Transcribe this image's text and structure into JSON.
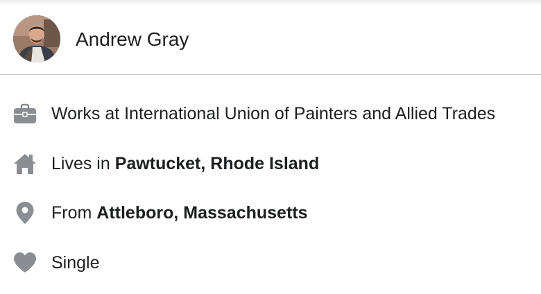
{
  "profile": {
    "name": "Andrew Gray"
  },
  "details": {
    "work": {
      "icon": "briefcase-icon",
      "prefix": "Works at International Union of Painters and Allied Trades"
    },
    "lives": {
      "icon": "home-icon",
      "prefix": "Lives in ",
      "place": "Pawtucket, Rhode Island"
    },
    "from": {
      "icon": "location-pin-icon",
      "prefix": "From ",
      "place": "Attleboro, Massachusetts"
    },
    "relationship": {
      "icon": "heart-icon",
      "status": "Single"
    }
  },
  "colors": {
    "icon": "#8a8d91",
    "text": "#1c1e21",
    "divider": "#c9ccd1"
  }
}
